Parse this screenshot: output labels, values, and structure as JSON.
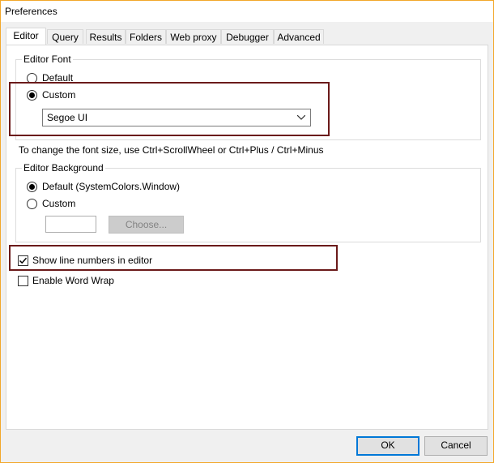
{
  "window": {
    "title": "Preferences"
  },
  "tabs": [
    "Editor",
    "Query",
    "Results",
    "Folders",
    "Web proxy",
    "Debugger",
    "Advanced"
  ],
  "editor_font": {
    "group_label": "Editor Font",
    "option_default": "Default",
    "option_custom": "Custom",
    "selected": "Custom",
    "font_value": "Segoe UI"
  },
  "font_size_hint": "To change the font size, use Ctrl+ScrollWheel or Ctrl+Plus / Ctrl+Minus",
  "editor_background": {
    "group_label": "Editor Background",
    "option_default": "Default (SystemColors.Window)",
    "option_custom": "Custom",
    "selected": "Default",
    "choose_label": "Choose..."
  },
  "checkboxes": {
    "show_line_numbers": {
      "label": "Show line numbers in editor",
      "checked": true
    },
    "word_wrap": {
      "label": "Enable Word Wrap",
      "checked": false
    }
  },
  "buttons": {
    "ok": "OK",
    "cancel": "Cancel"
  },
  "colors": {
    "highlight_border": "#6b1a1a",
    "default_button_border": "#0078d7"
  }
}
